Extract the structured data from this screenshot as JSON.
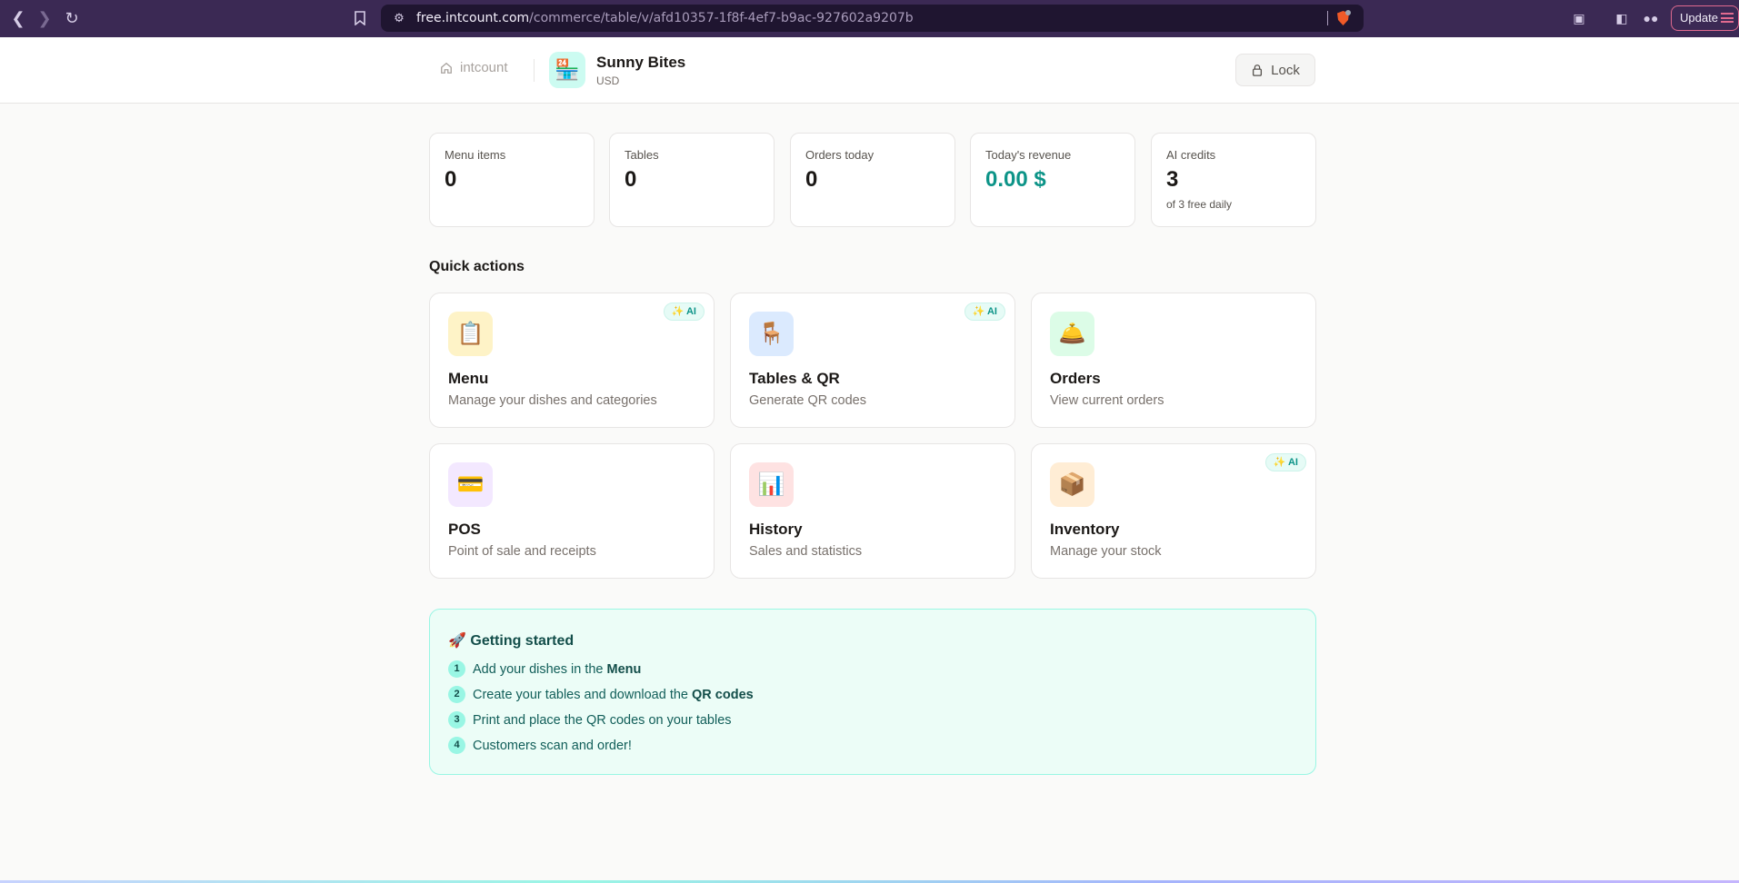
{
  "browser": {
    "url_host": "free.intcount.com",
    "url_path": "/commerce/table/v/afd10357-1f8f-4ef7-b9ac-927602a9207b",
    "update_label": "Update"
  },
  "header": {
    "home_label": "intcount",
    "store_name": "Sunny Bites",
    "currency": "USD",
    "lock_label": "Lock",
    "store_icon": "🏪"
  },
  "stats": [
    {
      "label": "Menu items",
      "value": "0"
    },
    {
      "label": "Tables",
      "value": "0"
    },
    {
      "label": "Orders today",
      "value": "0"
    },
    {
      "label": "Today's revenue",
      "value": "0.00 $"
    },
    {
      "label": "AI credits",
      "value": "3",
      "sub": "of 3 free daily"
    }
  ],
  "quick_actions": {
    "title": "Quick actions",
    "ai_badge": "✨ AI",
    "items": [
      {
        "icon": "📋",
        "title": "Menu",
        "desc": "Manage your dishes and categories"
      },
      {
        "icon": "🪑",
        "title": "Tables & QR",
        "desc": "Generate QR codes"
      },
      {
        "icon": "🛎️",
        "title": "Orders",
        "desc": "View current orders"
      },
      {
        "icon": "💳",
        "title": "POS",
        "desc": "Point of sale and receipts"
      },
      {
        "icon": "📊",
        "title": "History",
        "desc": "Sales and statistics"
      },
      {
        "icon": "📦",
        "title": "Inventory",
        "desc": "Manage your stock"
      }
    ]
  },
  "getting_started": {
    "title": "🚀 Getting started",
    "steps": [
      {
        "num": "1",
        "text": "Add your dishes in the ",
        "bold": "Menu"
      },
      {
        "num": "2",
        "text": "Create your tables and download the ",
        "bold": "QR codes"
      },
      {
        "num": "3",
        "text": "Print and place the QR codes on your tables",
        "bold": ""
      },
      {
        "num": "4",
        "text": "Customers scan and order!",
        "bold": ""
      }
    ]
  },
  "colors": {
    "accent": "#0d9488",
    "chrome": "#3b2954",
    "getting_started_bg": "#ecfdf7"
  }
}
